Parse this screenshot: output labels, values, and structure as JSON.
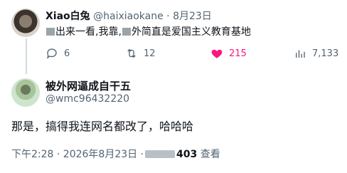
{
  "tweet1": {
    "display_name": "Xiao白兔",
    "handle": "@haixiaokane",
    "date": "8月23日",
    "separator": "·",
    "text_part1": "出来一看,我靠,",
    "text_part2": "外简直是爱国主义教育基地",
    "actions": {
      "reply_count": "6",
      "retweet_count": "12",
      "like_count": "215",
      "view_count": "7,133"
    },
    "like_color": "#f91880"
  },
  "tweet2": {
    "display_name": "被外网逼成自干五",
    "handle": "@wmc96432220",
    "text": "那是，搞得我连网名都改了，哈哈哈",
    "time": "下午2:28 · 2026年8月23日 ·",
    "views": "403",
    "views_label": "查看"
  }
}
